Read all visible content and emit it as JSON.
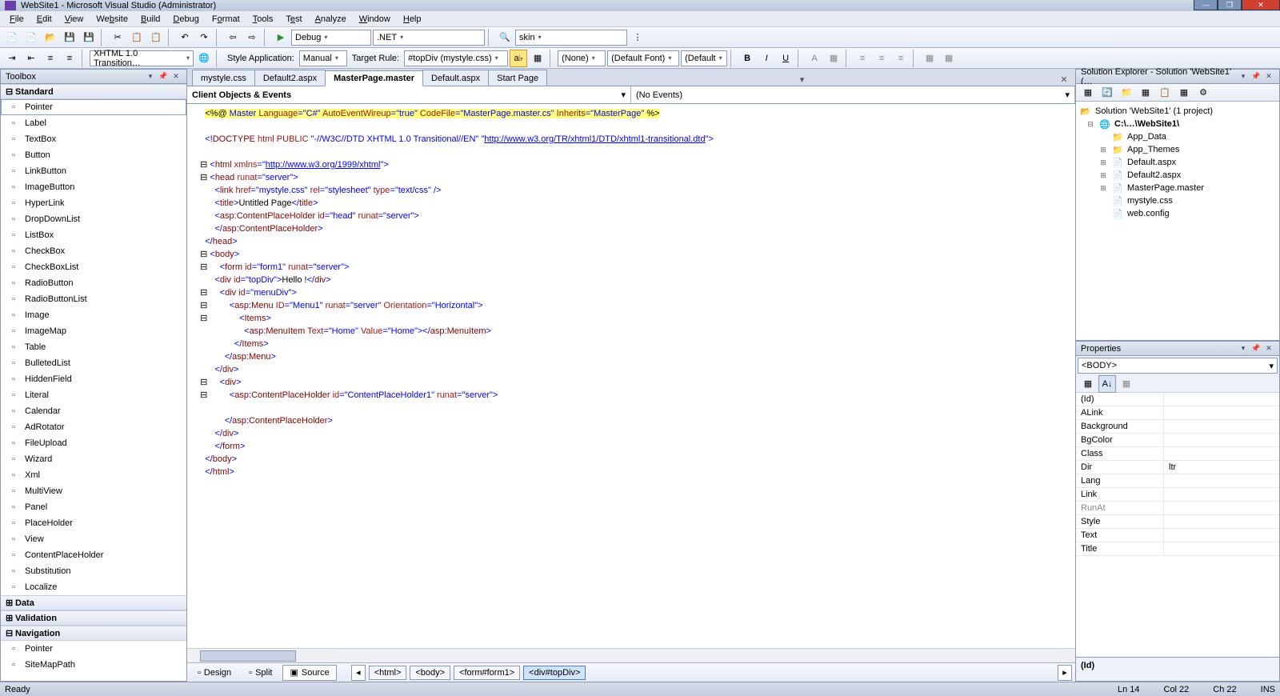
{
  "title": "WebSite1 - Microsoft Visual Studio (Administrator)",
  "menu": [
    "File",
    "Edit",
    "View",
    "Website",
    "Build",
    "Debug",
    "Format",
    "Tools",
    "Test",
    "Analyze",
    "Window",
    "Help"
  ],
  "toolbar1": {
    "config": "Debug",
    "platform": ".NET",
    "find": "skin"
  },
  "toolbar2": {
    "doctype": "XHTML 1.0 Transition…",
    "styleapp_label": "Style Application:",
    "styleapp": "Manual",
    "targetrule_label": "Target Rule:",
    "targetrule": "#topDiv (mystyle.css)",
    "fonttag": "(None)",
    "fontname": "(Default Font)",
    "fontsize": "(Default"
  },
  "toolbox": {
    "title": "Toolbox",
    "cats": [
      {
        "name": "Standard",
        "open": true
      },
      {
        "name": "Data",
        "open": false
      },
      {
        "name": "Validation",
        "open": false
      },
      {
        "name": "Navigation",
        "open": true
      }
    ],
    "std_items": [
      "Pointer",
      "Label",
      "TextBox",
      "Button",
      "LinkButton",
      "ImageButton",
      "HyperLink",
      "DropDownList",
      "ListBox",
      "CheckBox",
      "CheckBoxList",
      "RadioButton",
      "RadioButtonList",
      "Image",
      "ImageMap",
      "Table",
      "BulletedList",
      "HiddenField",
      "Literal",
      "Calendar",
      "AdRotator",
      "FileUpload",
      "Wizard",
      "Xml",
      "MultiView",
      "Panel",
      "PlaceHolder",
      "View",
      "ContentPlaceHolder",
      "Substitution",
      "Localize"
    ],
    "nav_items": [
      "Pointer",
      "SiteMapPath"
    ]
  },
  "tabs": [
    "mystyle.css",
    "Default2.aspx",
    "MasterPage.master",
    "Default.aspx",
    "Start Page"
  ],
  "active_tab": "MasterPage.master",
  "nav_left": "Client Objects & Events",
  "nav_right": "(No Events)",
  "code": {
    "l1_a": "<%@",
    "l1_b": " Master ",
    "l1_c": "Language",
    "l1_d": "=\"C#\"",
    "l1_e": " AutoEventWireup",
    "l1_f": "=\"true\"",
    "l1_g": " CodeFile",
    "l1_h": "=\"MasterPage.master.cs\"",
    "l1_i": " Inherits",
    "l1_j": "=\"MasterPage\"",
    "l1_k": " %>",
    "l3_a": "<!",
    "l3_b": "DOCTYPE ",
    "l3_c": "html ",
    "l3_d": "PUBLIC ",
    "l3_e": "\"-//W3C//DTD XHTML 1.0 Transitional//EN\" \"",
    "l3_f": "http://www.w3.org/TR/xhtml1/DTD/xhtml1-transitional.dtd",
    "l3_g": "\">",
    "l5_a": "<",
    "l5_b": "html ",
    "l5_c": "xmlns",
    "l5_d": "=\"",
    "l5_e": "http://www.w3.org/1999/xhtml",
    "l5_f": "\">",
    "l6": "<head runat=\"server\">",
    "l7": "    <link href=\"mystyle.css\" rel=\"stylesheet\" type=\"text/css\" />",
    "l8": "    <title>Untitled Page</title>",
    "l9": "    <asp:ContentPlaceHolder id=\"head\" runat=\"server\">",
    "l10": "    </asp:ContentPlaceHolder>",
    "l11": "</head>",
    "l12": "<body>",
    "l13": "    <form id=\"form1\" runat=\"server\">",
    "l14": "    <div id=\"topDiv\">Hello !</div>",
    "l15": "    <div id=\"menuDiv\">",
    "l16": "        <asp:Menu ID=\"Menu1\" runat=\"server\" Orientation=\"Horizontal\">",
    "l17": "            <Items>",
    "l18": "                <asp:MenuItem Text=\"Home\" Value=\"Home\"></asp:MenuItem>",
    "l19": "            </Items>",
    "l20": "        </asp:Menu>",
    "l21": "    </div>",
    "l22": "    <div>",
    "l23": "        <asp:ContentPlaceHolder id=\"ContentPlaceHolder1\" runat=\"server\">",
    "l24": "        ",
    "l25": "        </asp:ContentPlaceHolder>",
    "l26": "    </div>",
    "l27": "    </form>",
    "l28": "</body>",
    "l29": "</html>"
  },
  "views": {
    "design": "Design",
    "split": "Split",
    "source": "Source"
  },
  "breadcrumbs": [
    "<html>",
    "<body>",
    "<form#form1>",
    "<div#topDiv>"
  ],
  "soln": {
    "title": "Solution Explorer - Solution 'WebSite1' (…",
    "root": "Solution 'WebSite1' (1 project)",
    "proj": "C:\\…\\WebSite1\\",
    "items": [
      "App_Data",
      "App_Themes",
      "Default.aspx",
      "Default2.aspx",
      "MasterPage.master",
      "mystyle.css",
      "web.config"
    ]
  },
  "props": {
    "title": "Properties",
    "obj": "<BODY>",
    "rows": [
      {
        "n": "(Id)",
        "v": ""
      },
      {
        "n": "ALink",
        "v": ""
      },
      {
        "n": "Background",
        "v": ""
      },
      {
        "n": "BgColor",
        "v": ""
      },
      {
        "n": "Class",
        "v": ""
      },
      {
        "n": "Dir",
        "v": "ltr"
      },
      {
        "n": "Lang",
        "v": ""
      },
      {
        "n": "Link",
        "v": ""
      },
      {
        "n": "RunAt",
        "v": "",
        "g": true
      },
      {
        "n": "Style",
        "v": ""
      },
      {
        "n": "Text",
        "v": ""
      },
      {
        "n": "Title",
        "v": ""
      }
    ],
    "desc": "(Id)"
  },
  "status": {
    "ready": "Ready",
    "ln": "Ln 14",
    "col": "Col 22",
    "ch": "Ch 22",
    "ins": "INS"
  }
}
